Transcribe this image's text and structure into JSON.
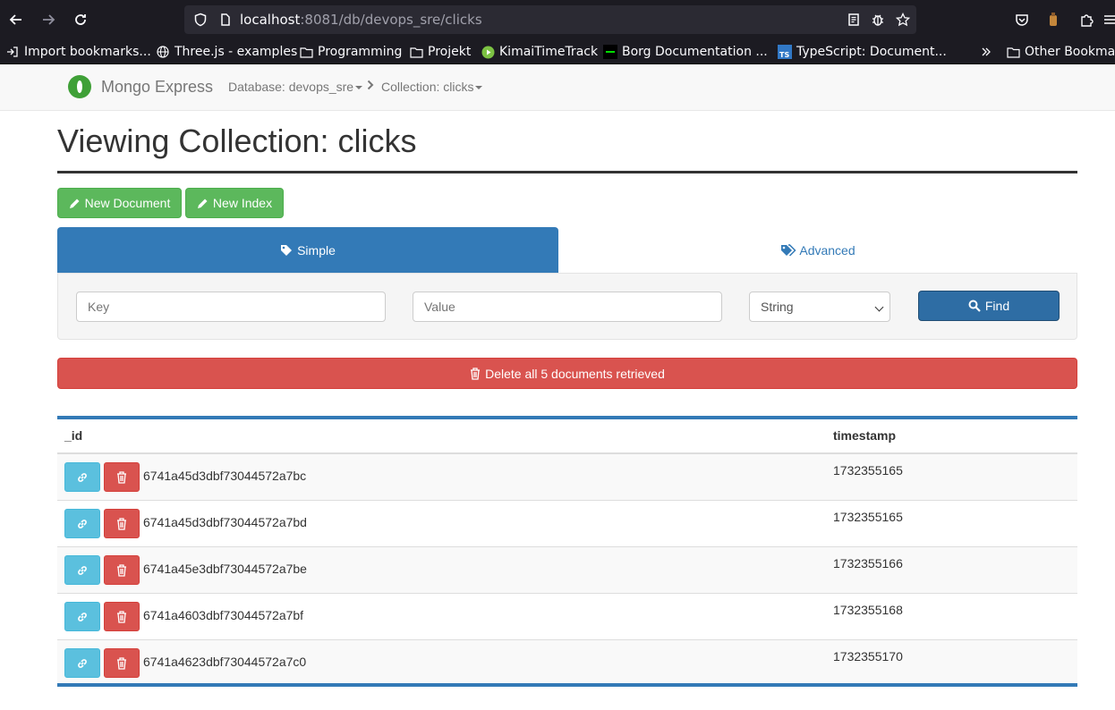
{
  "browser": {
    "url_host": "localhost",
    "url_rest": ":8081/db/devops_sre/clicks",
    "bookmarks": [
      {
        "label": "Import bookmarks..."
      },
      {
        "label": "Three.js - examples"
      },
      {
        "label": "Programming"
      },
      {
        "label": "Projekt"
      },
      {
        "label": "KimaiTimeTrack"
      },
      {
        "label": "Borg Documentation ..."
      },
      {
        "label": "TypeScript: Document..."
      }
    ],
    "other_bookmarks": "Other Bookmar"
  },
  "navbar": {
    "brand": "Mongo Express",
    "database_crumb": "Database: devops_sre",
    "collection_crumb": "Collection: clicks"
  },
  "page": {
    "title": "Viewing Collection: clicks",
    "new_document_label": "New Document",
    "new_index_label": "New Index",
    "tab_simple": "Simple",
    "tab_advanced": "Advanced",
    "key_placeholder": "Key",
    "value_placeholder": "Value",
    "type_selected": "String",
    "find_label": "Find",
    "delete_all_label": "Delete all 5 documents retrieved"
  },
  "table": {
    "columns": [
      "_id",
      "timestamp"
    ],
    "rows": [
      {
        "id": "6741a45d3dbf73044572a7bc",
        "timestamp": "1732355165"
      },
      {
        "id": "6741a45d3dbf73044572a7bd",
        "timestamp": "1732355165"
      },
      {
        "id": "6741a45e3dbf73044572a7be",
        "timestamp": "1732355166"
      },
      {
        "id": "6741a4603dbf73044572a7bf",
        "timestamp": "1732355168"
      },
      {
        "id": "6741a4623dbf73044572a7c0",
        "timestamp": "1732355170"
      }
    ]
  },
  "colors": {
    "primary": "#337ab7",
    "success": "#5cb85c",
    "danger": "#d9534f",
    "info": "#5bc0de"
  }
}
